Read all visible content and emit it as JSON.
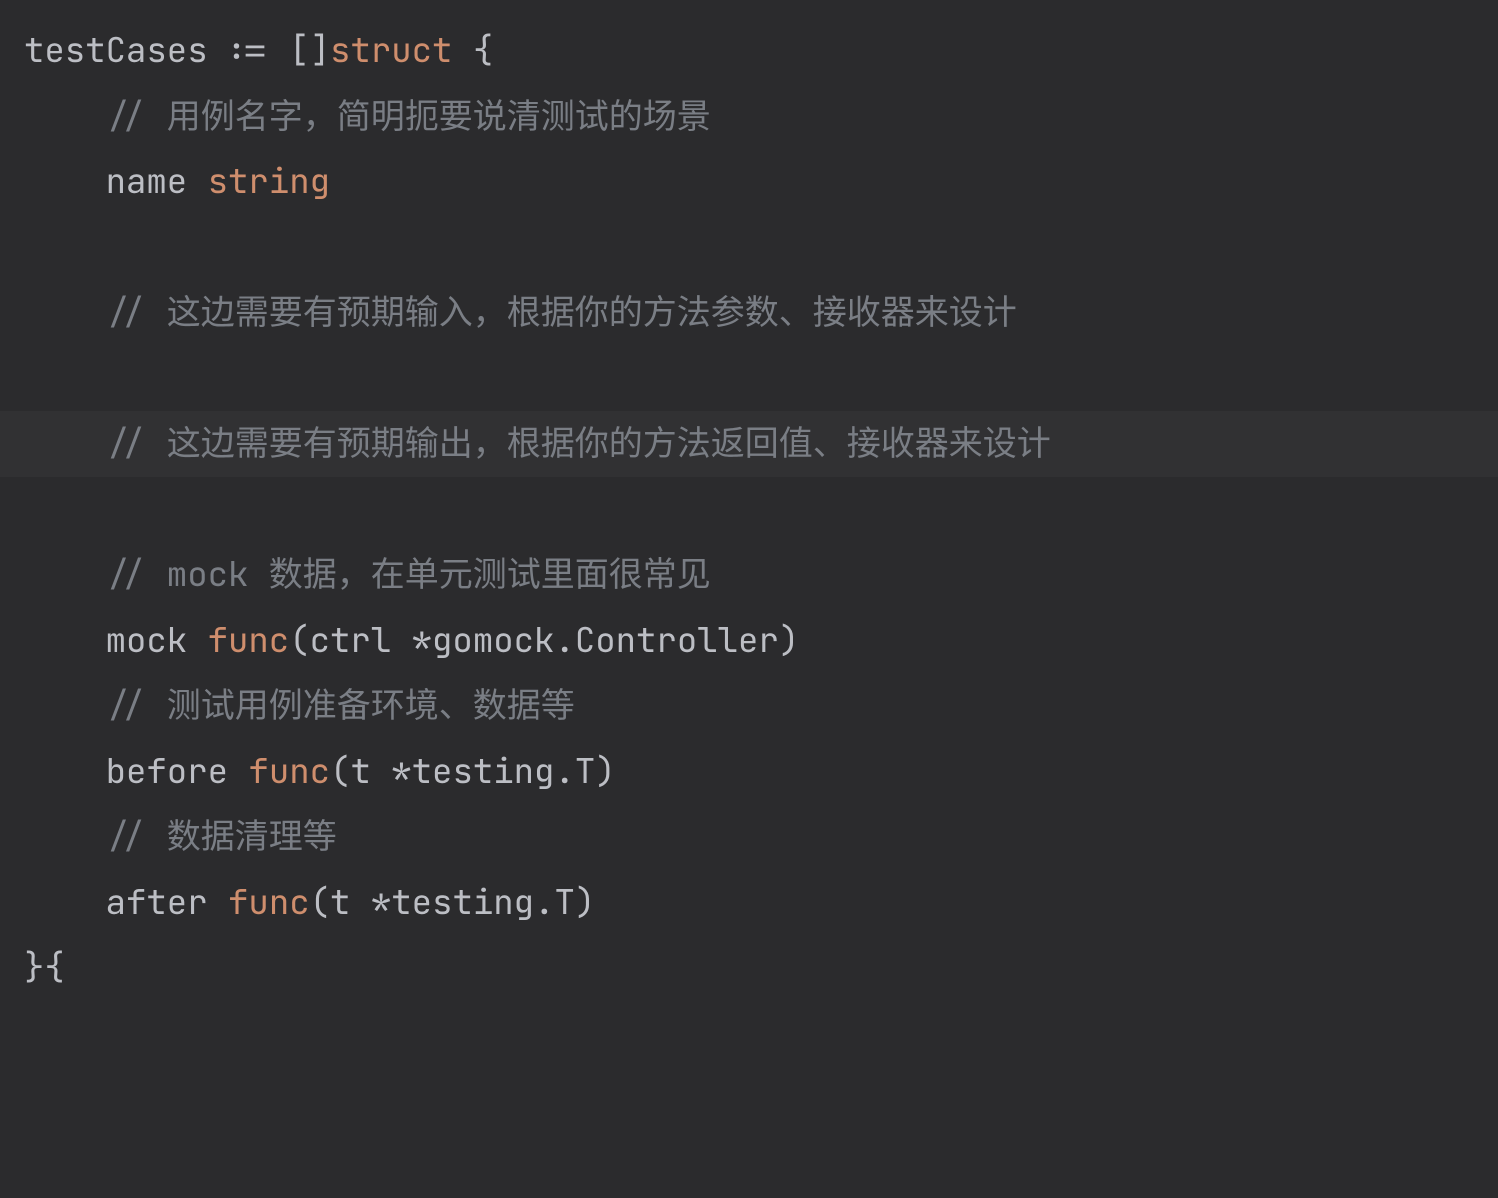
{
  "code": {
    "line1": {
      "a": "testCases ",
      "op": ":=",
      "b": " []",
      "kw": "struct",
      "c": " {"
    },
    "line2": {
      "indent": "    ",
      "comment": "// 用例名字，简明扼要说清测试的场景"
    },
    "line3": {
      "indent": "    ",
      "ident": "name ",
      "type": "string"
    },
    "blank1": "",
    "line5": {
      "indent": "    ",
      "comment": "// 这边需要有预期输入，根据你的方法参数、接收器来设计"
    },
    "blank2": "",
    "line7": {
      "indent": "    ",
      "comment": "// 这边需要有预期输出，根据你的方法返回值、接收器来设计"
    },
    "blank3": "",
    "line9": {
      "indent": "    ",
      "comment": "// mock 数据，在单元测试里面很常见"
    },
    "line10": {
      "indent": "    ",
      "ident": "mock ",
      "kw": "func",
      "open": "(",
      "param": "ctrl ",
      "star": "*",
      "pkg": "gomock",
      "dot": ".",
      "type": "Controller",
      "close": ")"
    },
    "line11": {
      "indent": "    ",
      "comment": "// 测试用例准备环境、数据等"
    },
    "line12": {
      "indent": "    ",
      "ident": "before ",
      "kw": "func",
      "open": "(",
      "param": "t ",
      "star": "*",
      "pkg": "testing",
      "dot": ".",
      "type": "T",
      "close": ")"
    },
    "line13": {
      "indent": "    ",
      "comment": "// 数据清理等"
    },
    "line14": {
      "indent": "    ",
      "ident": "after ",
      "kw": "func",
      "open": "(",
      "param": "t ",
      "star": "*",
      "pkg": "testing",
      "dot": ".",
      "type": "T",
      "close": ")"
    },
    "line15": {
      "close": "}{"
    }
  }
}
